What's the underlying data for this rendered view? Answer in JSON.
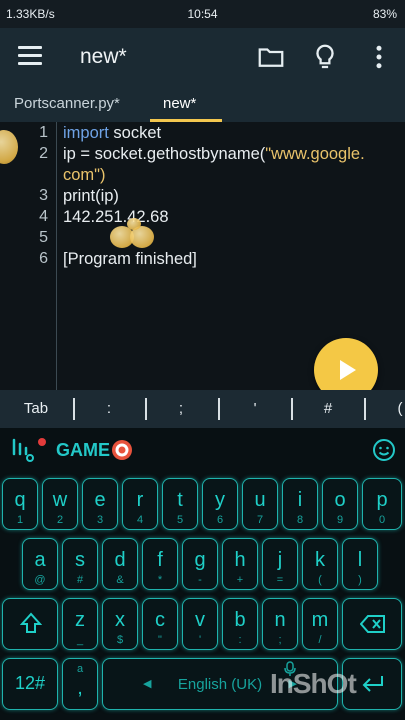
{
  "status": {
    "left": "1.33KB/s",
    "time": "10:54",
    "battery": "83%"
  },
  "toolbar": {
    "title": "new*"
  },
  "tabs": [
    {
      "label": "Portscanner.py*"
    },
    {
      "label": "new*"
    }
  ],
  "editor": {
    "line_numbers": [
      "1",
      "2",
      "3",
      "4",
      "5",
      "6"
    ],
    "lines": [
      {
        "kw": "import",
        "rest": " socket"
      },
      {
        "pre": "ip = socket.gethostbyname(",
        "str": "\"www.google.",
        "cont": "com\")"
      },
      {
        "text": "print(ip)"
      },
      {
        "text": "142.251.42.68"
      },
      {
        "text": ""
      },
      {
        "text": "[Program finished]"
      }
    ]
  },
  "symbols": [
    "Tab",
    ":",
    ";",
    "'",
    "#",
    "("
  ],
  "keyboard": {
    "banner": "GAME",
    "row1": [
      [
        "q",
        "1"
      ],
      [
        "w",
        "2"
      ],
      [
        "e",
        "3"
      ],
      [
        "r",
        "4"
      ],
      [
        "t",
        "5"
      ],
      [
        "y",
        "6"
      ],
      [
        "u",
        "7"
      ],
      [
        "i",
        "8"
      ],
      [
        "o",
        "9"
      ],
      [
        "p",
        "0"
      ]
    ],
    "row2": [
      [
        "a",
        "@"
      ],
      [
        "s",
        "#"
      ],
      [
        "d",
        "&"
      ],
      [
        "f",
        "*"
      ],
      [
        "g",
        "-"
      ],
      [
        "h",
        "+"
      ],
      [
        "j",
        "="
      ],
      [
        "k",
        "("
      ],
      [
        "l",
        ")"
      ]
    ],
    "row3": [
      [
        "z",
        "_"
      ],
      [
        "x",
        "$"
      ],
      [
        "c",
        "\""
      ],
      [
        "v",
        "'"
      ],
      [
        "b",
        ":"
      ],
      [
        "n",
        ";"
      ],
      [
        "m",
        "/"
      ]
    ],
    "numbers_key": "12#",
    "comma_key": ",",
    "comma_sub": "a",
    "space_label": "English (UK)"
  },
  "watermark": "InShOt"
}
